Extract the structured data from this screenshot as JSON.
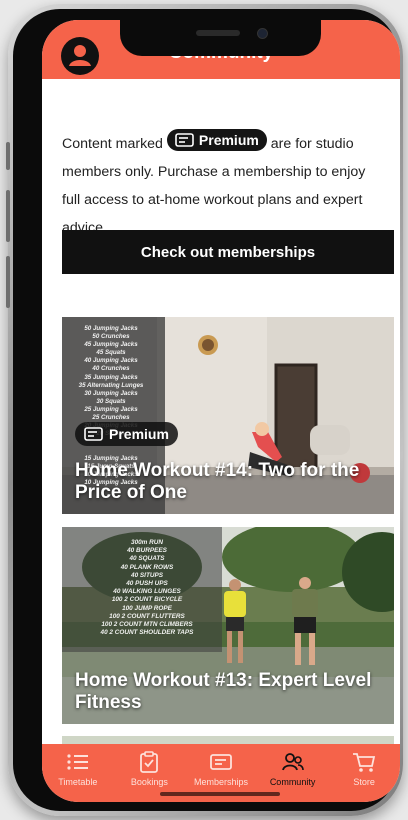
{
  "header": {
    "title": "Community",
    "avatar_icon": "user-circle-icon"
  },
  "info": {
    "prefix": "Content marked",
    "badge": "Premium",
    "suffix": "are for studio members only. Purchase a membership to enjoy full access to at-home workout plans and expert advice."
  },
  "cta": {
    "label": "Check out memberships"
  },
  "cards": [
    {
      "title": "Home Workout #14: Two for the Price of One",
      "badge": "Premium",
      "list_text": "50 Jumping Jacks\n50 Crunches\n45 Jumping Jacks\n45 Squats\n40 Jumping Jacks\n40 Crunches\n35 Jumping Jacks\n35 Alternating Lunges\n30 Jumping Jacks\n30 Squats\n25 Jumping Jacks\n25 Crunches\n20 Jumping Jacks\n20 Squats\n\n\n15 Jumping Jacks\n15 Jump Squats\n10 Jumping Jacks\n10 Jumping Jacks"
    },
    {
      "title": "Home Workout #13: Expert Level Fitness",
      "list_text": "300m RUN\n40 BURPEES\n40 SQUATS\n40 PLANK ROWS\n40 SITUPS\n40 PUSH UPS\n40 WALKING LUNGES\n100 2 COUNT BICYCLE\n100 JUMP ROPE\n100 2 COUNT FLUTTERS\n100 2 COUNT MTN CLIMBERS\n40 2 COUNT SHOULDER TAPS"
    }
  ],
  "tabs": [
    {
      "label": "Timetable",
      "icon": "list-icon"
    },
    {
      "label": "Bookings",
      "icon": "clipboard-check-icon"
    },
    {
      "label": "Memberships",
      "icon": "membership-card-icon"
    },
    {
      "label": "Community",
      "icon": "people-icon",
      "active": true
    },
    {
      "label": "Store",
      "icon": "shopping-cart-icon"
    }
  ],
  "colors": {
    "accent": "#f5634a",
    "dark": "#111111"
  }
}
